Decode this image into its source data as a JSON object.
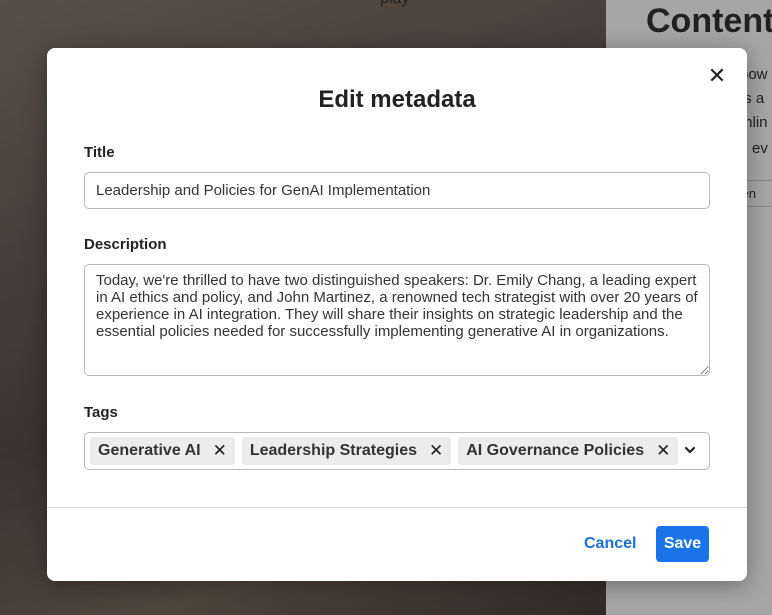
{
  "background": {
    "top_partial_text": "play",
    "heading_partial": "Content",
    "side_lines": [
      "pow",
      "ts a",
      "mlin",
      "ev"
    ],
    "chip_partial": "iten"
  },
  "modal": {
    "title": "Edit metadata",
    "close_symbol": "✕",
    "fields": {
      "title": {
        "label": "Title",
        "value": "Leadership and Policies for GenAI Implementation"
      },
      "description": {
        "label": "Description",
        "value": "Today, we're thrilled to have two distinguished speakers: Dr. Emily Chang, a leading expert in AI ethics and policy, and John Martinez, a renowned tech strategist with over 20 years of experience in AI integration. They will share their insights on strategic leadership and the essential policies needed for successfully implementing generative AI in organizations."
      },
      "tags": {
        "label": "Tags",
        "items": [
          {
            "label": "Generative AI",
            "remove": "✕"
          },
          {
            "label": "Leadership Strategies",
            "remove": "✕"
          },
          {
            "label": "AI Governance Policies",
            "remove": "✕"
          }
        ]
      }
    },
    "actions": {
      "cancel_label": "Cancel",
      "save_label": "Save"
    }
  },
  "colors": {
    "accent": "#1a73e8",
    "link": "#1a6fd6"
  }
}
